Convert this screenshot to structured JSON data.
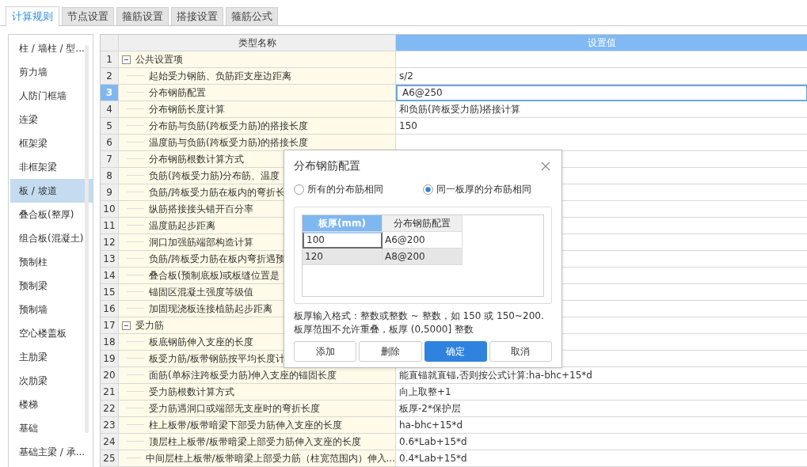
{
  "tabs": [
    {
      "label": "计算规则",
      "selected": true
    },
    {
      "label": "节点设置",
      "selected": false
    },
    {
      "label": "箍筋设置",
      "selected": false
    },
    {
      "label": "搭接设置",
      "selected": false
    },
    {
      "label": "箍筋公式",
      "selected": false
    }
  ],
  "sidebar": {
    "items": [
      {
        "label": "柱 / 墙柱 / 型...",
        "selected": false
      },
      {
        "label": "剪力墙",
        "selected": false
      },
      {
        "label": "人防门框墙",
        "selected": false
      },
      {
        "label": "连梁",
        "selected": false
      },
      {
        "label": "框架梁",
        "selected": false
      },
      {
        "label": "非框架梁",
        "selected": false
      },
      {
        "label": "板 / 坡道",
        "selected": true
      },
      {
        "label": "叠合板(整厚)",
        "selected": false
      },
      {
        "label": "组合板(混凝土)",
        "selected": false
      },
      {
        "label": "预制柱",
        "selected": false
      },
      {
        "label": "预制梁",
        "selected": false
      },
      {
        "label": "预制墙",
        "selected": false
      },
      {
        "label": "空心楼盖板",
        "selected": false
      },
      {
        "label": "主肋梁",
        "selected": false
      },
      {
        "label": "次肋梁",
        "selected": false
      },
      {
        "label": "楼梯",
        "selected": false
      },
      {
        "label": "基础",
        "selected": false
      },
      {
        "label": "基础主梁 / 承...",
        "selected": false
      }
    ]
  },
  "table": {
    "columns": [
      {
        "label": "类型名称",
        "selected": false
      },
      {
        "label": "设置值",
        "selected": true
      }
    ],
    "rows": [
      {
        "number": "1",
        "kind": "group",
        "expanded": true,
        "name": "公共设置项",
        "value": "",
        "selected": false
      },
      {
        "number": "2",
        "kind": "item",
        "name": "起始受力钢筋、负筋距支座边距离",
        "value": "s/2",
        "selected": false
      },
      {
        "number": "3",
        "kind": "item",
        "name": "分布钢筋配置",
        "value": "A6@250",
        "selected": true
      },
      {
        "number": "4",
        "kind": "item",
        "name": "分布钢筋长度计算",
        "value": "和负筋(跨板受力筋)搭接计算",
        "selected": false
      },
      {
        "number": "5",
        "kind": "item",
        "name": "分布筋与负筋(跨板受力筋)的搭接长度",
        "value": "150",
        "selected": false
      },
      {
        "number": "6",
        "kind": "item",
        "name": "温度筋与负筋(跨板受力筋)的搭接长度",
        "value": "",
        "selected": false
      },
      {
        "number": "7",
        "kind": "item",
        "name": "分布钢筋根数计算方式",
        "value": "",
        "selected": false
      },
      {
        "number": "8",
        "kind": "item",
        "name": "负筋(跨板受力筋)分布筋、温度",
        "value": "",
        "selected": false
      },
      {
        "number": "9",
        "kind": "item",
        "name": "负筋/跨板受力筋在板内的弯折长",
        "value": "",
        "selected": false
      },
      {
        "number": "10",
        "kind": "item",
        "name": "纵筋搭接接头错开百分率",
        "value": "",
        "selected": false
      },
      {
        "number": "11",
        "kind": "item",
        "name": "温度筋起步距离",
        "value": "",
        "selected": false
      },
      {
        "number": "12",
        "kind": "item",
        "name": "洞口加强筋端部构造计算",
        "value": "",
        "selected": false
      },
      {
        "number": "13",
        "kind": "item",
        "name": "负筋/跨板受力筋在板内弯折遇预",
        "value": "",
        "selected": false
      },
      {
        "number": "14",
        "kind": "item",
        "name": "叠合板(预制底板)或板缝位置是",
        "value": "",
        "selected": false
      },
      {
        "number": "15",
        "kind": "item",
        "name": "锚固区混凝土强度等级值",
        "value": "",
        "selected": false
      },
      {
        "number": "16",
        "kind": "item",
        "name": "加固现浇板连接植筋起步距离",
        "value": "",
        "selected": false
      },
      {
        "number": "17",
        "kind": "group",
        "expanded": true,
        "name": "受力筋",
        "value": "",
        "selected": false
      },
      {
        "number": "18",
        "kind": "item",
        "name": "板底钢筋伸入支座的长度",
        "value": "",
        "selected": false
      },
      {
        "number": "19",
        "kind": "item",
        "name": "板受力筋/板带钢筋按平均长度计",
        "value": "",
        "selected": false
      },
      {
        "number": "20",
        "kind": "item",
        "name": "面筋(单标注跨板受力筋)伸入支座的锚固长度",
        "value": "能直锚就直锚,否则按公式计算:ha-bhc+15*d",
        "selected": false
      },
      {
        "number": "21",
        "kind": "item",
        "name": "受力筋根数计算方式",
        "value": "向上取整+1",
        "selected": false
      },
      {
        "number": "22",
        "kind": "item",
        "name": "受力筋遇洞口或端部无支座时的弯折长度",
        "value": "板厚-2*保护层",
        "selected": false
      },
      {
        "number": "23",
        "kind": "item",
        "name": "柱上板带/板带暗梁下部受力筋伸入支座的长度",
        "value": "ha-bhc+15*d",
        "selected": false
      },
      {
        "number": "24",
        "kind": "item",
        "name": "顶层柱上板带/板带暗梁上部受力筋伸入支座的长度",
        "value": "0.6*Lab+15*d",
        "selected": false
      },
      {
        "number": "25",
        "kind": "item",
        "name": "中间层柱上板带/板带暗梁上部受力筋（柱宽范围内）伸入...",
        "value": "0.4*Lab+15*d",
        "selected": false
      }
    ]
  },
  "dialog": {
    "title": "分布钢筋配置",
    "radios": [
      {
        "label": "所有的分布筋相同",
        "selected": false
      },
      {
        "label": "同一板厚的分布筋相同",
        "selected": true
      }
    ],
    "table": {
      "columns": [
        {
          "label": "板厚(mm)",
          "selected": true
        },
        {
          "label": "分布钢筋配置",
          "selected": false
        }
      ],
      "rows": [
        {
          "cells": [
            "100",
            "A6@200"
          ],
          "selected": false,
          "editing": true
        },
        {
          "cells": [
            "120",
            "A8@200"
          ],
          "selected": true,
          "editing": false
        }
      ]
    },
    "hint": [
      "板厚输入格式：整数或整数 ~ 整数，如 150 或 150~200.",
      "板厚范围不允许重叠，板厚 (0,5000] 整数"
    ],
    "buttons": [
      {
        "label": "添加",
        "primary": false
      },
      {
        "label": "删除",
        "primary": false
      },
      {
        "label": "确定",
        "primary": true
      },
      {
        "label": "取消",
        "primary": false
      }
    ]
  }
}
